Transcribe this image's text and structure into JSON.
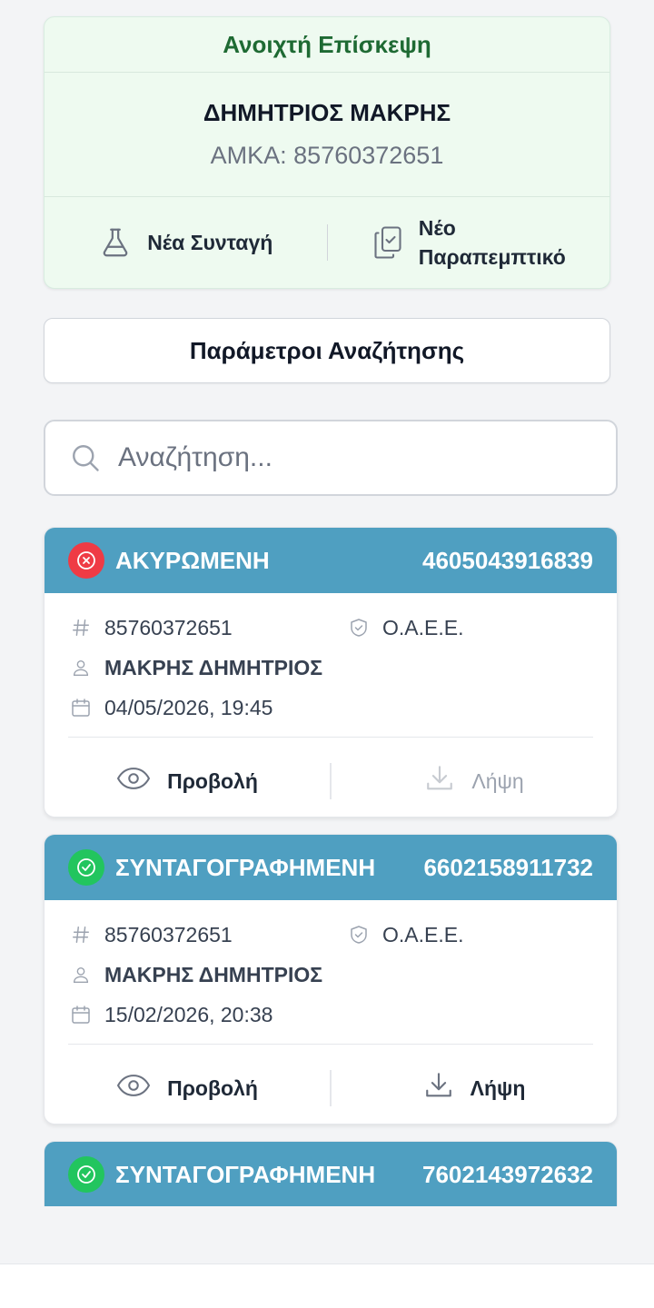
{
  "visit": {
    "title": "Ανοιχτή Επίσκεψη",
    "patient_name": "ΔΗΜΗΤΡΙΟΣ ΜΑΚΡΗΣ",
    "amka": "ΑΜΚΑ: 85760372651",
    "new_prescription": "Νέα Συνταγή",
    "new_referral_line1": "Νέο",
    "new_referral_line2": "Παραπεμπτικό"
  },
  "params_button": "Παράμετροι Αναζήτησης",
  "search": {
    "placeholder": "Αναζήτηση..."
  },
  "prescriptions": [
    {
      "status": "ΑΚΥΡΩΜΕΝΗ",
      "status_type": "cancelled",
      "number": "4605043916839",
      "amka": "85760372651",
      "insurer": "Ο.Α.Ε.Ε.",
      "patient": "ΜΑΚΡΗΣ ΔΗΜΗΤΡΙΟΣ",
      "datetime": "04/05/2026, 19:45",
      "view_label": "Προβολή",
      "download_label": "Λήψη",
      "download_enabled": false
    },
    {
      "status": "ΣΥΝΤΑΓΟΓΡΑΦΗΜΕΝΗ",
      "status_type": "prescribed",
      "number": "6602158911732",
      "amka": "85760372651",
      "insurer": "Ο.Α.Ε.Ε.",
      "patient": "ΜΑΚΡΗΣ ΔΗΜΗΤΡΙΟΣ",
      "datetime": "15/02/2026, 20:38",
      "view_label": "Προβολή",
      "download_label": "Λήψη",
      "download_enabled": true
    },
    {
      "status": "ΣΥΝΤΑΓΟΓΡΑΦΗΜΕΝΗ",
      "status_type": "prescribed",
      "number": "7602143972632"
    }
  ],
  "colors": {
    "header_blue": "#4f9fc1",
    "cancelled_red": "#ef3b45",
    "prescribed_green": "#22c55e",
    "visit_green": "#1e6a33"
  }
}
